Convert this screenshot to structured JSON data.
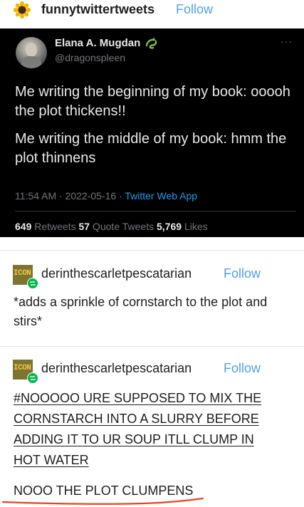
{
  "header": {
    "blog_name": "funnytwittertweets",
    "follow_label": "Follow",
    "avatar_icon": "sunflower-icon"
  },
  "tweet": {
    "display_name": "Elana A. Mugdan",
    "handle": "@dragonspleen",
    "name_emoji": "dragon-icon",
    "more_label": "···",
    "line1": "Me writing the beginning of my book: ooooh the plot thickens!!",
    "line2": "Me writing the middle of my book: hmm the plot thinnens",
    "time": "11:54 AM · 2022-05-16 · ",
    "app": "Twitter Web App",
    "retweets_count": "649",
    "retweets_label": " Retweets ",
    "quotes_count": "57",
    "quotes_label": " Quote Tweets ",
    "likes_count": "5,769",
    "likes_label": " Likes",
    "colors": {
      "background": "#000000",
      "text": "#e7e9ea",
      "muted": "#71767b",
      "link": "#1d9bf0"
    }
  },
  "reblog1": {
    "avatar_text": "ICON",
    "username": "derinthescarletpescatarian",
    "follow_label": "Follow",
    "text": "*adds a sprinkle of cornstarch to the plot and stirs*"
  },
  "reblog2": {
    "avatar_text": "ICON",
    "username": "derinthescarletpescatarian",
    "follow_label": "Follow",
    "tag_lines": [
      "#NOOOOO URE SUPPOSED TO MIX THE",
      "CORNSTARCH INTO A SLURRY BEFORE",
      "ADDING IT TO UR SOUP ITLL CLUMP IN",
      "HOT WATER"
    ],
    "final_text": "NOOO THE PLOT CLUMPENS"
  },
  "colors": {
    "follow": "#4ea1e8",
    "underline_annotation": "#e8461f",
    "reblog_badge": "#00b84e"
  }
}
